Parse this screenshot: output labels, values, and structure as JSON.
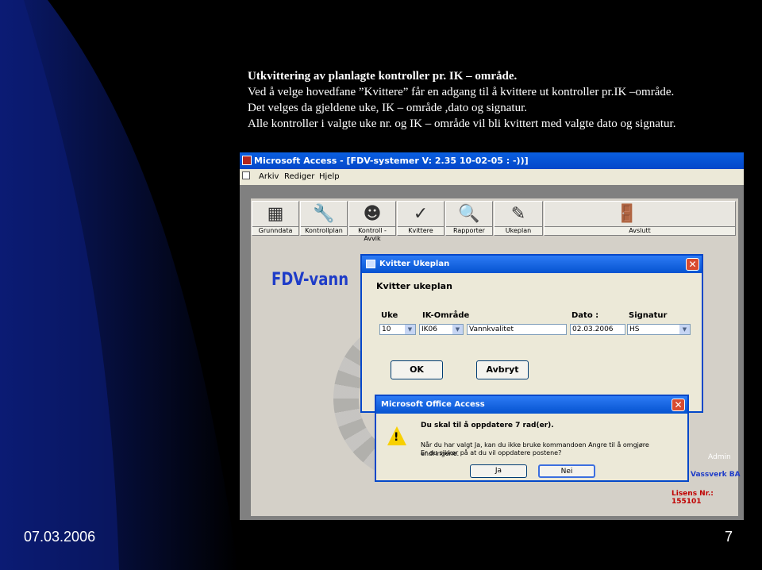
{
  "slide": {
    "title": "Utkvittering av planlagte kontroller pr. IK – område.",
    "lines": [
      "Ved å velge hovedfane ”Kvittere” får en adgang til å kvittere ut kontroller pr.IK –område.",
      "Det velges da gjeldene uke, IK – område ,dato og signatur.",
      "Alle kontroller i valgte uke nr. og IK – område vil bli kvittert med valgte dato og signatur."
    ],
    "date": "07.03.2006",
    "page_number": "7"
  },
  "app": {
    "window_title": "Microsoft Access - [FDV-systemer  V: 2.35 10-02-05 : -))]",
    "menu": [
      "Arkiv",
      "Rediger",
      "Hjelp"
    ],
    "toolbar": [
      {
        "label": "Grunndata",
        "icon": "database-icon"
      },
      {
        "label": "Kontrollplan",
        "icon": "wrench-icon"
      },
      {
        "label": "Kontroll - Avvik",
        "icon": "person-icon"
      },
      {
        "label": "Kvittere",
        "icon": "checkmark-icon"
      },
      {
        "label": "Rapporter",
        "icon": "report-magnifier-icon"
      },
      {
        "label": "Ukeplan",
        "icon": "notepad-icon"
      },
      {
        "label": "Avslutt",
        "icon": "exit-door-icon"
      }
    ],
    "brand": "FDV-vann",
    "admin": "Admin",
    "company": "Vassverk BA",
    "license": "Lisens Nr.: 155101"
  },
  "kvitter_dialog": {
    "title": "Kvitter Ukeplan",
    "heading": "Kvitter ukeplan",
    "labels": {
      "uke": "Uke",
      "ik": "IK-Område",
      "dato": "Dato :",
      "signatur": "Signatur"
    },
    "values": {
      "uke": "10",
      "ik_code": "IK06",
      "ik_name": "Vannkvalitet",
      "dato": "02.03.2006",
      "signatur": "HS"
    },
    "ok_label": "OK",
    "cancel_label": "Avbryt"
  },
  "confirm_dialog": {
    "title": "Microsoft Office Access",
    "message": "Du skal til å oppdatere 7 rad(er).",
    "detail_1": "Når du har valgt Ja, kan du ikke bruke kommandoen Angre til å omgjøre endringene.",
    "detail_2": "Er du sikker på at du vil oppdatere postene?",
    "yes_label": "Ja",
    "no_label": "Nei"
  },
  "colors": {
    "slide_dark": "#000000",
    "slide_blue": "#0a1a6e",
    "xp_title": "#0347c9",
    "brand_blue": "#1e3cc8",
    "license_red": "#c00000"
  }
}
